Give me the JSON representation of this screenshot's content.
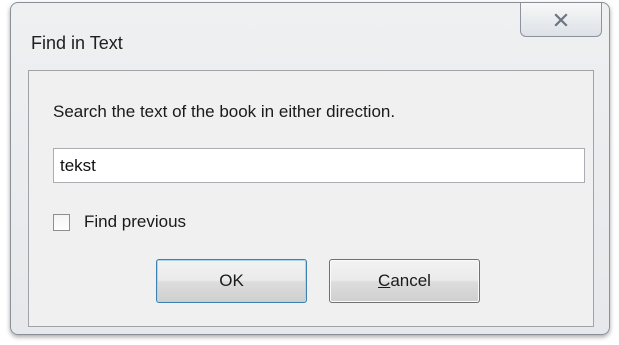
{
  "window": {
    "title": "Find in Text",
    "close_icon": "close-icon"
  },
  "dialog": {
    "prompt": "Search the text of the book in either direction.",
    "search_value": "tekst",
    "find_previous_label": "Find previous",
    "find_previous_checked": false,
    "ok_label": "OK",
    "cancel_label": "Cancel"
  }
}
